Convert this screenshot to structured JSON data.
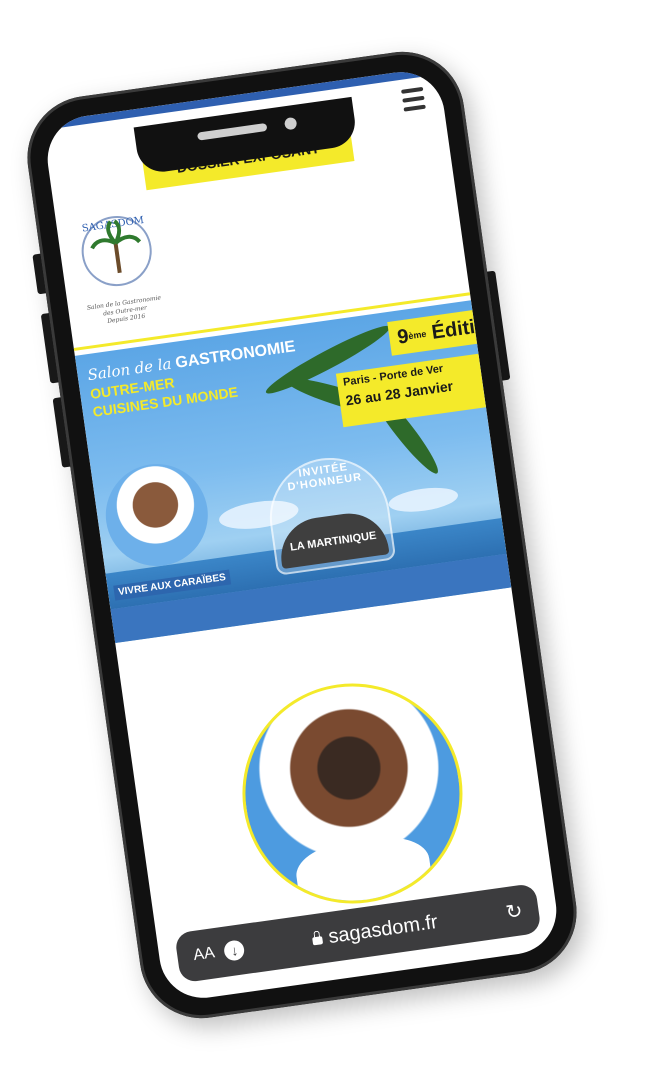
{
  "header": {
    "dossier_label": "DOSSIER EXPOSANT"
  },
  "logo": {
    "name": "SAGASDOM",
    "tagline_lines": [
      "Salon de la Gastronomie",
      "des Outre-mer",
      "Depuis 2016"
    ],
    "icon": "palm-tree-emblem"
  },
  "banner": {
    "line1_script": "Salon de la",
    "line1_bold": "GASTRONOMIE",
    "line2": "OUTRE-MER",
    "line3": "CUISINES DU MONDE",
    "edition_number": "9",
    "edition_suffix": "ème",
    "edition_word": "Éditi",
    "venue": "Paris - Porte de Ver",
    "dates": "26 au 28 Janvier",
    "honneur_title": "INVITÉE D'HONNEUR",
    "honneur_name": "LA MARTINIQUE",
    "caption": "VIVRE AUX CARAÏBES"
  },
  "browser": {
    "aa_label": "AA",
    "url": "sagasdom.fr",
    "download_icon": "download-icon",
    "lock_icon": "lock-icon",
    "reload_icon": "reload-icon"
  },
  "colors": {
    "accent_yellow": "#f4ea2a",
    "brand_blue": "#2e5fb0",
    "urlbar": "#3c3c3e"
  }
}
